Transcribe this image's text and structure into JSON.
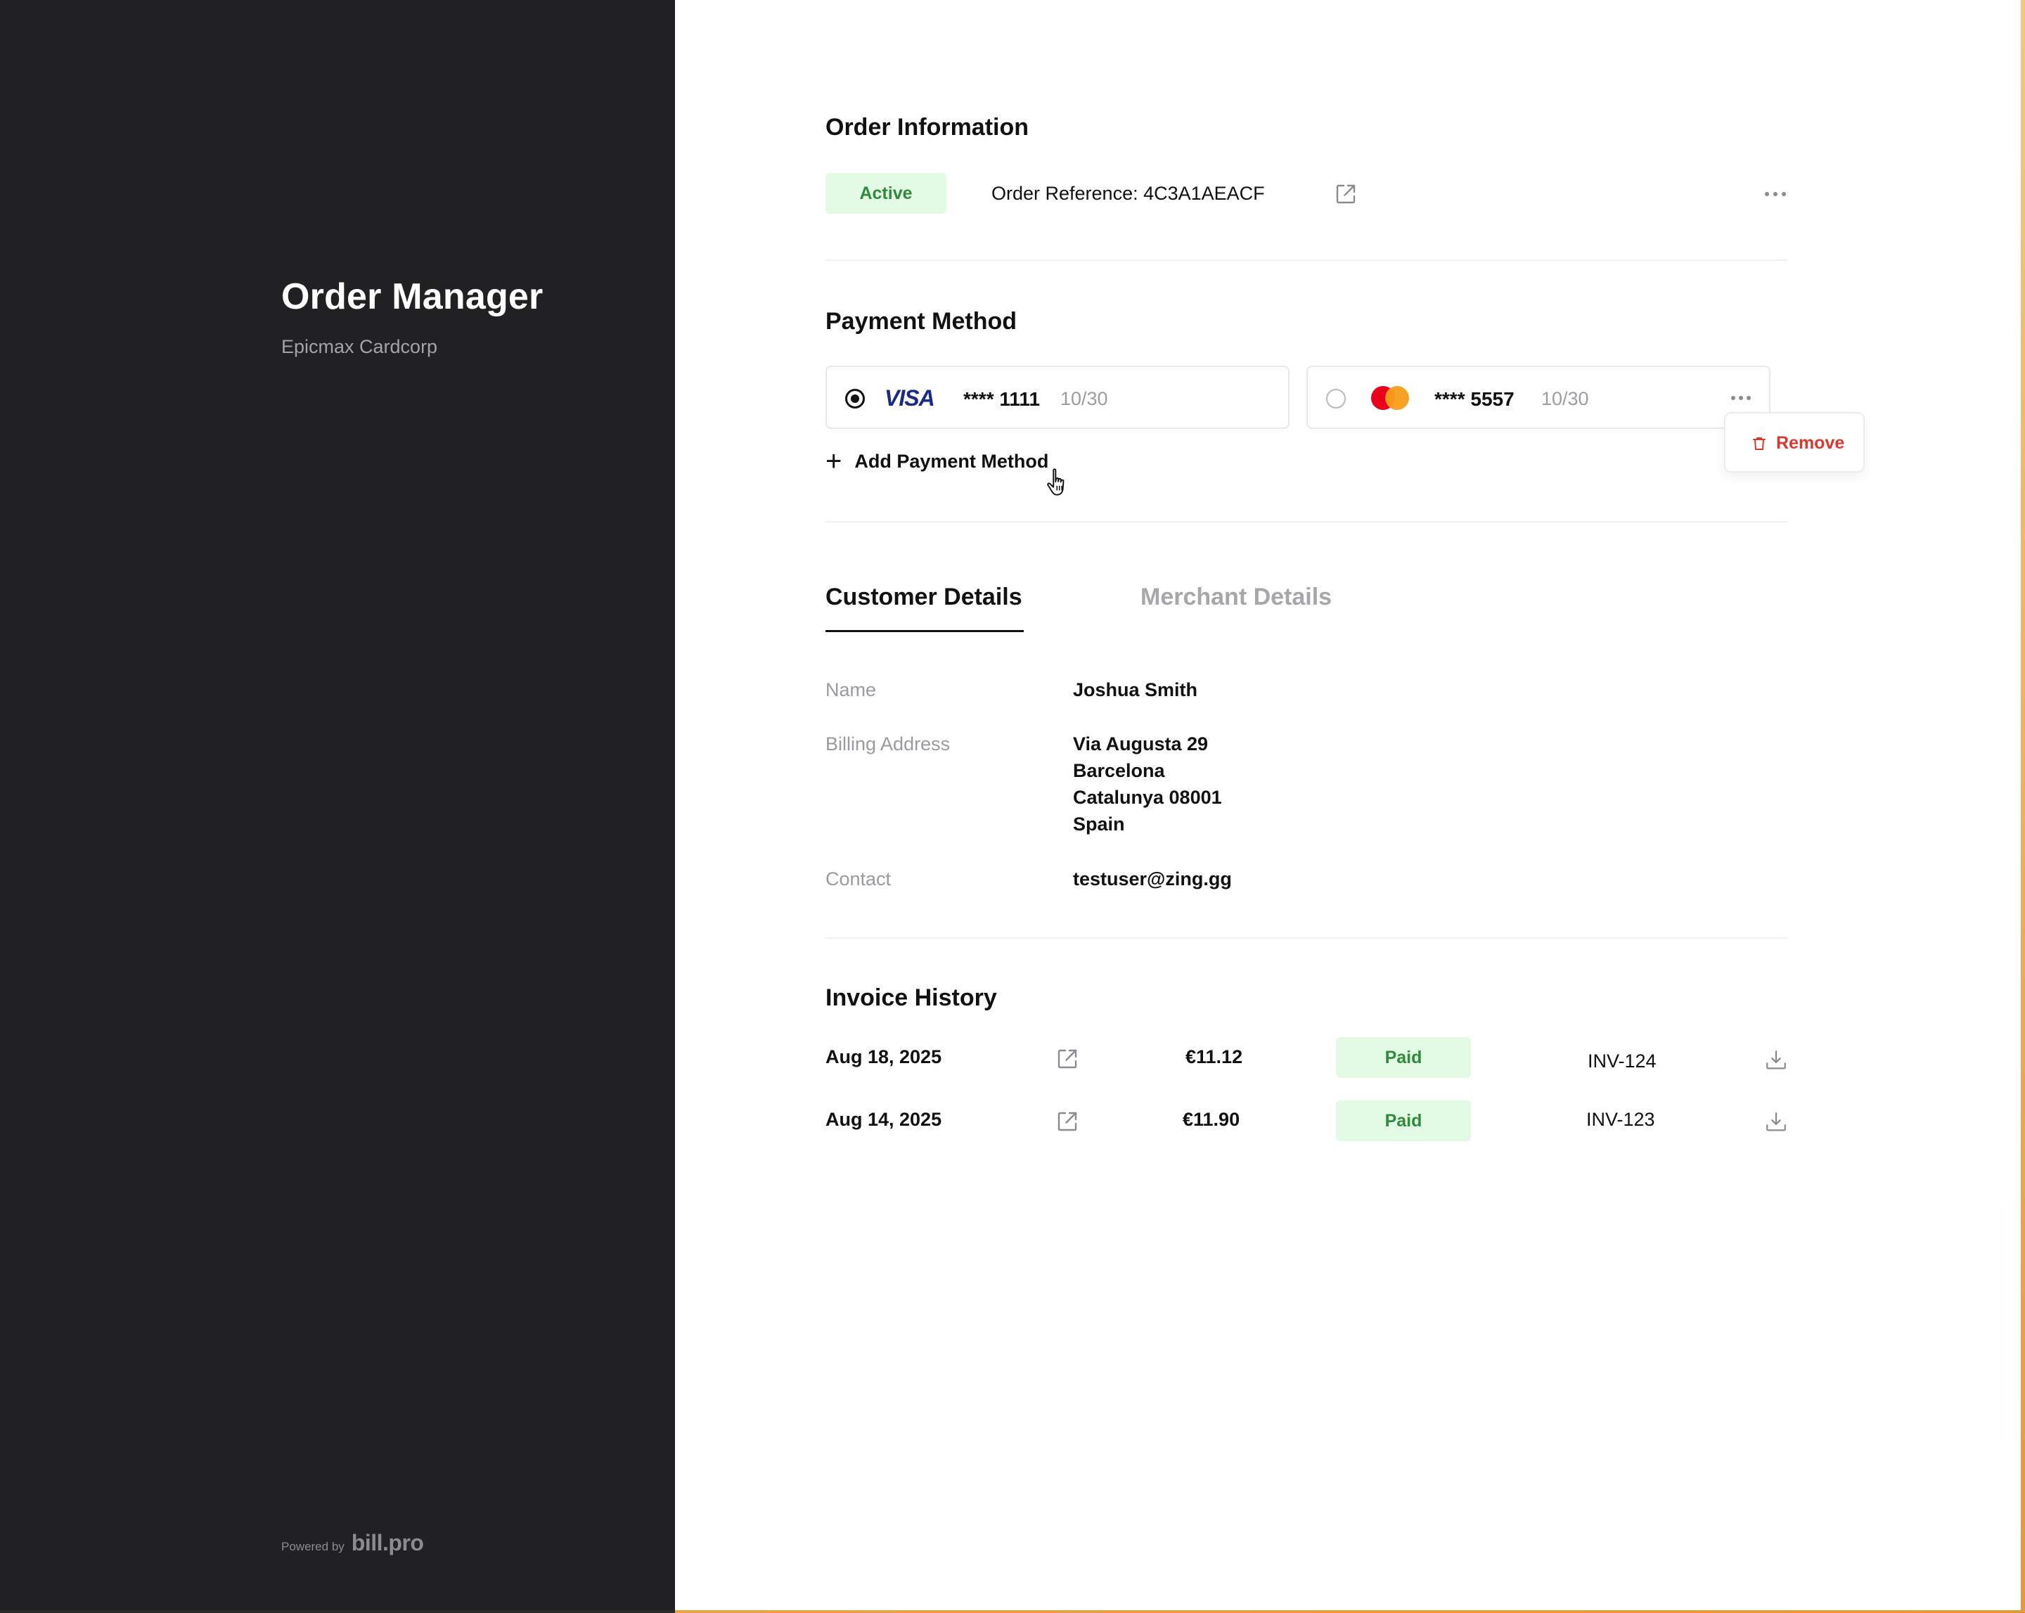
{
  "sidebar": {
    "title": "Order Manager",
    "subtitle": "Epicmax Cardcorp",
    "powered_by": "Powered by",
    "brand": "bill.pro"
  },
  "order": {
    "section_title": "Order Information",
    "status": "Active",
    "reference_label": "Order Reference: 4C3A1AEACF",
    "open_icon": "external-link-icon",
    "menu_icon": "more-horizontal-icon"
  },
  "payment": {
    "section_title": "Payment Method",
    "cards": [
      {
        "brand": "VISA",
        "number": "**** 1111",
        "expiry": "10/30",
        "selected": true
      },
      {
        "brand": "mastercard",
        "number": "**** 5557",
        "expiry": "10/30",
        "selected": false
      }
    ],
    "add_label": "Add Payment Method",
    "menu": {
      "remove_label": "Remove",
      "icon": "trash-icon"
    }
  },
  "tabs": [
    {
      "label": "Customer Details",
      "active": true
    },
    {
      "label": "Merchant Details",
      "active": false
    }
  ],
  "customer": {
    "name_label": "Name",
    "name_value": "Joshua Smith",
    "address_label": "Billing Address",
    "address_lines": [
      "Via Augusta 29",
      "Barcelona",
      "Catalunya 08001",
      "Spain"
    ],
    "contact_label": "Contact",
    "contact_value": "testuser@zing.gg"
  },
  "invoices": {
    "section_title": "Invoice History",
    "rows": [
      {
        "date": "Aug 18, 2025",
        "amount": "€11.12",
        "status": "Paid",
        "id": "INV-124"
      },
      {
        "date": "Aug 14, 2025",
        "amount": "€11.90",
        "status": "Paid",
        "id": "INV-123"
      }
    ]
  },
  "colors": {
    "sidebar_bg": "#212123",
    "badge_bg": "#e3fbe5",
    "badge_text": "#2f8a3c",
    "danger": "#d9382e"
  }
}
